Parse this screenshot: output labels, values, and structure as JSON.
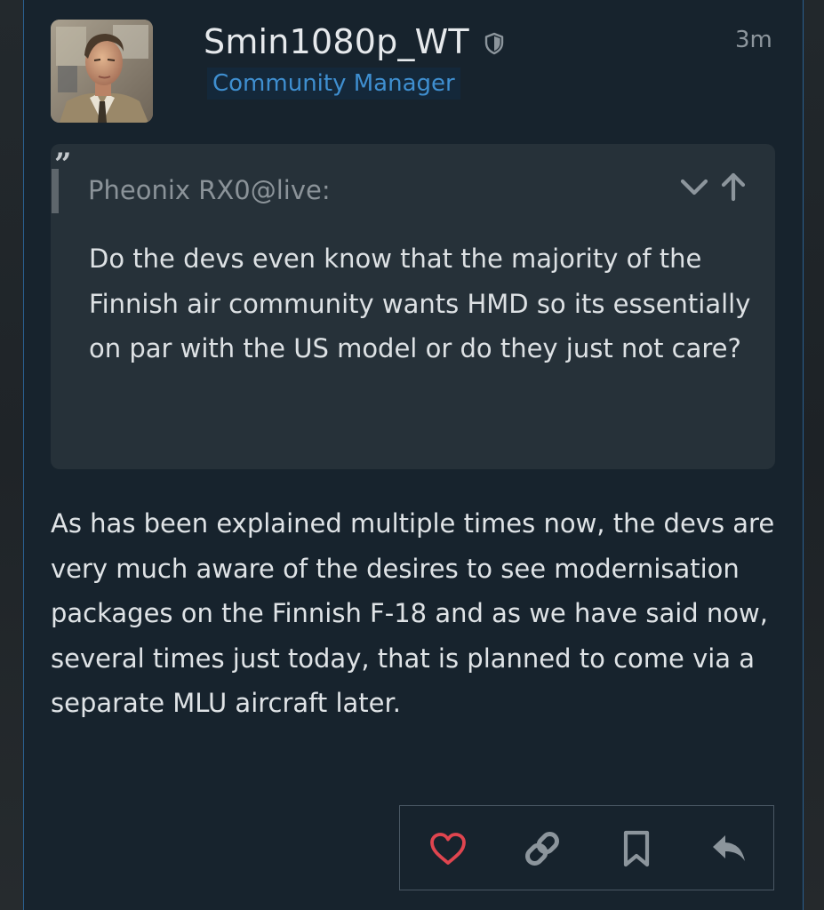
{
  "post": {
    "username": "Smin1080p_WT",
    "role": "Community Manager",
    "timestamp": "3m",
    "quote": {
      "author": "Pheonix RX0@live:",
      "text": "Do the devs even know that the majority of the Finnish air community wants HMD so its essentially on par with the US model or do they just not care?"
    },
    "body": "As has been explained multiple times now, the devs are very much aware of the desires to see modernisation packages on the Finnish F-18 and as we have said now, several times just today, that is planned to come via a separate MLU aircraft later."
  },
  "icons": {
    "moderator": "shield-icon",
    "quote_mark": "quote-mark-icon",
    "expand": "chevron-down-icon",
    "go_to_quoted": "arrow-up-icon",
    "like": "heart-icon",
    "share": "link-icon",
    "bookmark": "bookmark-icon",
    "reply": "reply-icon"
  },
  "colors": {
    "background": "#17232d",
    "accent_border": "#2a5f8f",
    "role_text": "#3f8fd0",
    "quote_background": "#263139",
    "like_red": "#e0454f",
    "icon_gray": "#8c959c"
  }
}
